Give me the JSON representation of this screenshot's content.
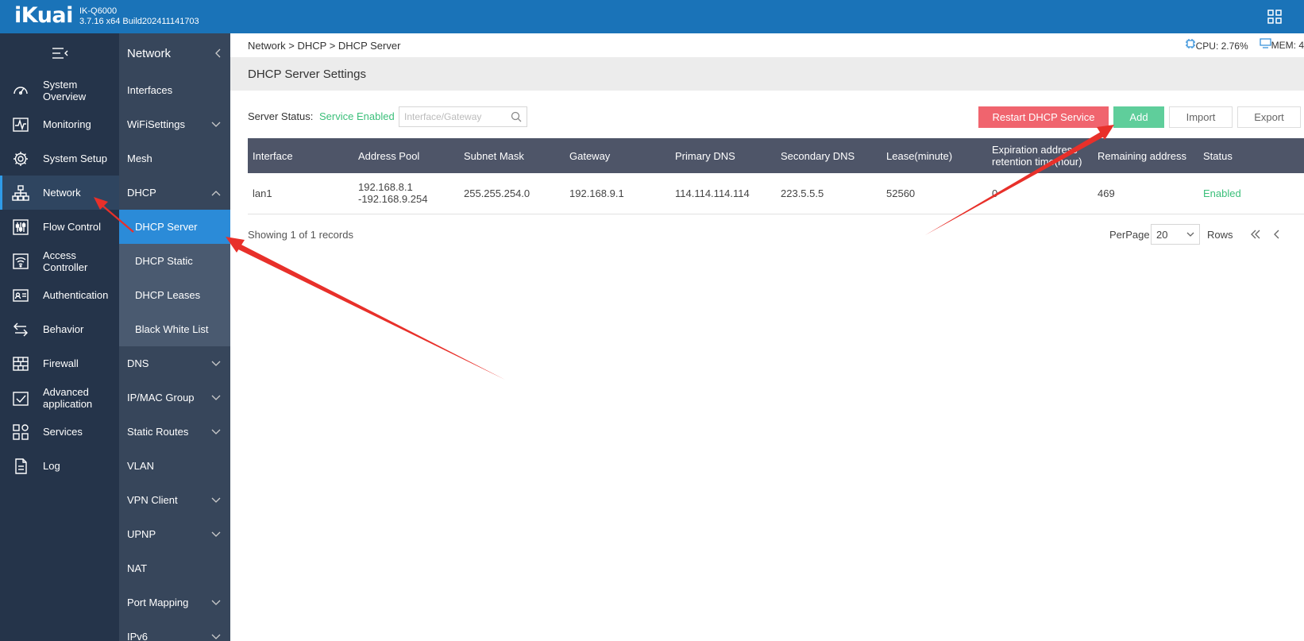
{
  "header": {
    "logo": "iKuai",
    "model": "IK-Q6000",
    "build": "3.7.16 x64 Build202411141703"
  },
  "leftnav": {
    "items": [
      {
        "label": "System Overview",
        "icon": "speedometer-icon"
      },
      {
        "label": "Monitoring",
        "icon": "pulse-icon"
      },
      {
        "label": "System Setup",
        "icon": "gear-icon"
      },
      {
        "label": "Network",
        "icon": "network-icon"
      },
      {
        "label": "Flow Control",
        "icon": "sliders-icon"
      },
      {
        "label": "Access Controller",
        "icon": "wifi-icon"
      },
      {
        "label": "Authentication",
        "icon": "id-card-icon"
      },
      {
        "label": "Behavior",
        "icon": "arrows-icon"
      },
      {
        "label": "Firewall",
        "icon": "brick-wall-icon"
      },
      {
        "label": "Advanced application",
        "icon": "check-box-icon"
      },
      {
        "label": "Services",
        "icon": "apps-icon"
      },
      {
        "label": "Log",
        "icon": "document-icon"
      }
    ]
  },
  "subnav": {
    "title": "Network",
    "items": {
      "interfaces": "Interfaces",
      "wifi": "WiFiSettings",
      "mesh": "Mesh",
      "dhcp": "DHCP",
      "dhcp_server": "DHCP Server",
      "dhcp_static": "DHCP Static",
      "dhcp_leases": "DHCP Leases",
      "black_white": "Black White List",
      "dns": "DNS",
      "ipmac": "IP/MAC Group",
      "static_routes": "Static Routes",
      "vlan": "VLAN",
      "vpn_client": "VPN Client",
      "upnp": "UPNP",
      "nat": "NAT",
      "port_mapping": "Port Mapping",
      "ipv6": "IPv6"
    }
  },
  "breadcrumb": "Network > DHCP > DHCP Server",
  "sysinfo": {
    "cpu": "CPU: 2.76%",
    "mem": "MEM: 4"
  },
  "page_title": "DHCP Server Settings",
  "toolbar": {
    "server_status_label": "Server Status:",
    "server_status_value": "Service Enabled",
    "search_placeholder": "Interface/Gateway",
    "restart_label": "Restart DHCP Service",
    "add_label": "Add",
    "import_label": "Import",
    "export_label": "Export"
  },
  "table": {
    "headers": [
      "Interface",
      "Address Pool",
      "Subnet Mask",
      "Gateway",
      "Primary DNS",
      "Secondary DNS",
      "Lease(minute)",
      "Expiration address retention time(hour)",
      "Remaining address",
      "Status"
    ],
    "rows": [
      {
        "interface": "lan1",
        "pool_start": "192.168.8.1",
        "pool_end": "-192.168.9.254",
        "mask": "255.255.254.0",
        "gateway": "192.168.9.1",
        "dns1": "114.114.114.114",
        "dns2": "223.5.5.5",
        "lease": "52560",
        "retention": "0",
        "remaining": "469",
        "status": "Enabled"
      }
    ]
  },
  "footer": {
    "records": "Showing 1 of 1 records",
    "perpage_label": "PerPage",
    "perpage_value": "20",
    "rows_label": "Rows"
  },
  "colors": {
    "topbar": "#1a73b8",
    "leftnav": "#25344a",
    "subnav": "#37465b",
    "active": "#2b8bd8",
    "restart_button": "#f0646e",
    "add_button": "#5fce9b",
    "enabled_text": "#3bbf7a",
    "table_header": "#4e5568",
    "annotation_arrow": "#e8302a"
  }
}
